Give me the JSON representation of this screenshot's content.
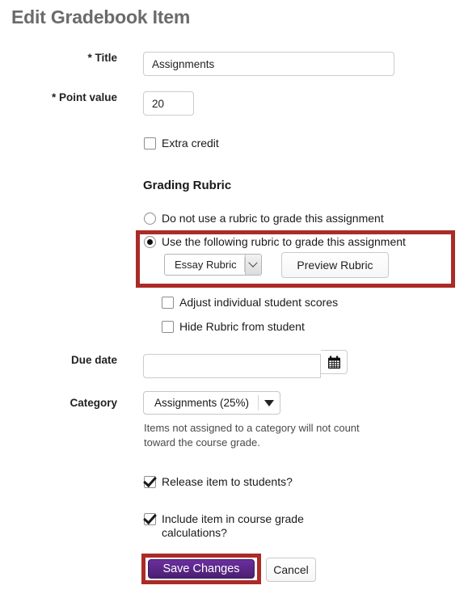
{
  "page": {
    "title": "Edit Gradebook Item"
  },
  "form": {
    "title_field": {
      "label": "* Title",
      "value": "Assignments",
      "placeholder": ""
    },
    "point_value_field": {
      "label": "* Point value",
      "value": "20",
      "placeholder": ""
    },
    "extra_credit": {
      "label": "Extra credit",
      "checked": false
    },
    "grading_rubric": {
      "heading": "Grading Rubric",
      "options": [
        {
          "label": "Do not use a rubric to grade this assignment",
          "selected": false
        },
        {
          "label": "Use the following rubric to grade this assignment",
          "selected": true
        }
      ],
      "rubric_select": {
        "value": "Essay Rubric",
        "options": [
          "Essay Rubric"
        ]
      },
      "preview_button": "Preview Rubric",
      "sub_options": [
        {
          "label": "Adjust individual student scores",
          "checked": false
        },
        {
          "label": "Hide Rubric from student",
          "checked": false
        }
      ]
    },
    "due_date": {
      "label": "Due date",
      "value": "",
      "placeholder": "",
      "calendar_icon": "calendar-icon"
    },
    "category": {
      "label": "Category",
      "value": "Assignments (25%)",
      "options": [
        "Assignments (25%)"
      ],
      "help_text": "Items not assigned to a category will not count toward the course grade."
    },
    "release_item": {
      "label": "Release item to students?",
      "checked": true
    },
    "include_in_grade": {
      "label": "Include item in course grade calculations?",
      "checked": true
    }
  },
  "actions": {
    "save_label": "Save Changes",
    "cancel_label": "Cancel"
  },
  "colors": {
    "highlight": "#ab2b26",
    "save_button": "#5a2889",
    "title_text": "#6b6b6b"
  }
}
